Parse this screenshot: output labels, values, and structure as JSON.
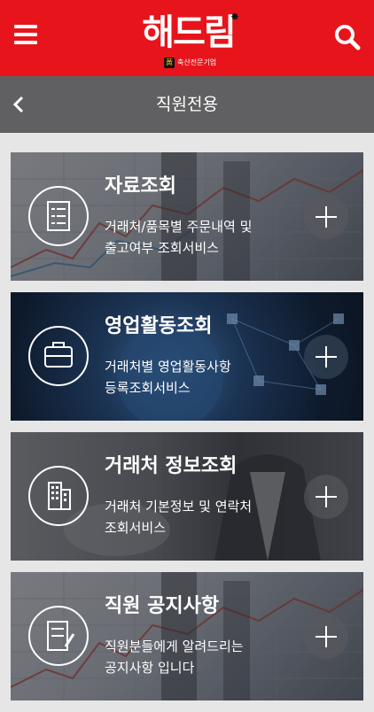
{
  "header": {
    "logo_text": "해드림",
    "logo_badge": "黃",
    "logo_tagline": "축산전문기업",
    "menu_icon": "hamburger-menu-icon",
    "search_icon": "search-icon",
    "accent_color": "#e8141b"
  },
  "subheader": {
    "title": "직원전용",
    "back_icon": "chevron-left-icon"
  },
  "cards": [
    {
      "title": "자료조회",
      "desc_line1": "거래처/품목별 주문내역 및",
      "desc_line2": "출고여부 조회서비스",
      "icon": "document-list-icon"
    },
    {
      "title": "영업활동조회",
      "desc_line1": "거래처별 영업활동사항",
      "desc_line2": "등록조회서비스",
      "icon": "briefcase-icon"
    },
    {
      "title": "거래처 정보조회",
      "desc_line1": "거래처 기본정보 및 연락처",
      "desc_line2": "조회서비스",
      "icon": "building-icon"
    },
    {
      "title": "직원 공지사항",
      "desc_line1": "직원분들에게 알려드리는",
      "desc_line2": "공지사항 입니다",
      "icon": "document-edit-icon"
    }
  ]
}
